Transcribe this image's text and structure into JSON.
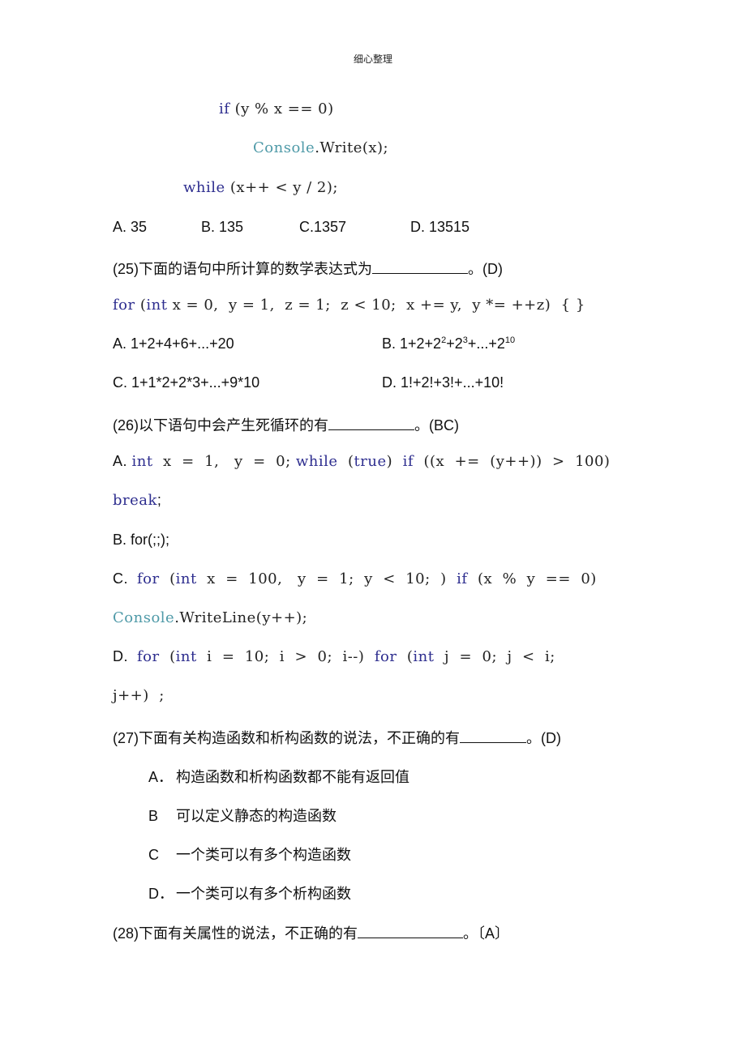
{
  "header": "细心整理",
  "q24": {
    "code": {
      "if_kw": "if",
      "if_rest": " (y % x == 0)",
      "console": "Console",
      "write_rest": ".Write(x);",
      "while_kw": "while",
      "while_rest": " (x++ < y / 2);"
    },
    "options": [
      "A. 35",
      "B. 135",
      "C.1357",
      "D. 13515"
    ]
  },
  "q25": {
    "question": "(25)下面的语句中所计算的数学表达式为",
    "answer": "。(D)",
    "code": {
      "for_kw": "for",
      "paren": " (",
      "int_kw": "int",
      "rest": " x = 0,  y = 1,  z = 1;  z < 10;  x += y,  y *= ++z)  { }"
    },
    "options": {
      "a": "A. 1+2+4+6+...+20",
      "b_prefix": "B. 1+2+2",
      "b_sup1": "2",
      "b_mid": "+2",
      "b_sup2": "3",
      "b_mid2": "+...+2",
      "b_sup3": "10",
      "c": "C. 1+1*2+2*3+...+9*10",
      "d": "D. 1!+2!+3!+...+10!"
    }
  },
  "q26": {
    "question": "(26)以下语句中会产生死循环的有",
    "answer": "。(BC)",
    "a": {
      "label": "A. ",
      "int_kw": "int",
      "part1": "  x  =  1,   y  =  0; ",
      "while_kw": "while",
      "part2": "  (",
      "true_kw": "true",
      "part3": ")  ",
      "if_kw": "if",
      "part4": "  ((x  +=  (y++))  >  100)",
      "break_kw": "break",
      "part5": ";"
    },
    "b": "B. for(;;);",
    "c": {
      "label": "C.  ",
      "for_kw": "for",
      "part1": "  (",
      "int_kw": "int",
      "part2": "  x  =  100,   y  =  1;  y  <  10;  )  ",
      "if_kw": "if",
      "part3": "  (x  %  y  ==  0)",
      "console": "Console",
      "part4": ".WriteLine(y++);"
    },
    "d": {
      "label": "D.  ",
      "for_kw": "for",
      "part1": "  (",
      "int_kw": "int",
      "part2": "  i  =  10;  i  >  0;  i--)  ",
      "for_kw2": "for",
      "part3": "  (",
      "int_kw2": "int",
      "part4": "  j  =  0;  j  <  i;",
      "part5": "j++)  ;"
    }
  },
  "q27": {
    "question": "(27)下面有关构造函数和析构函数的说法，不正确的有",
    "answer": "。(D)",
    "options": [
      {
        "label": "A．",
        "text": "构造函数和析构函数都不能有返回值"
      },
      {
        "label": "B",
        "text": "可以定义静态的构造函数"
      },
      {
        "label": "C",
        "text": "一个类可以有多个构造函数"
      },
      {
        "label": "D．",
        "text": "一个类可以有多个析构函数"
      }
    ]
  },
  "q28": {
    "question": "(28)下面有关属性的说法，不正确的有",
    "answer": "。〔A〕"
  }
}
